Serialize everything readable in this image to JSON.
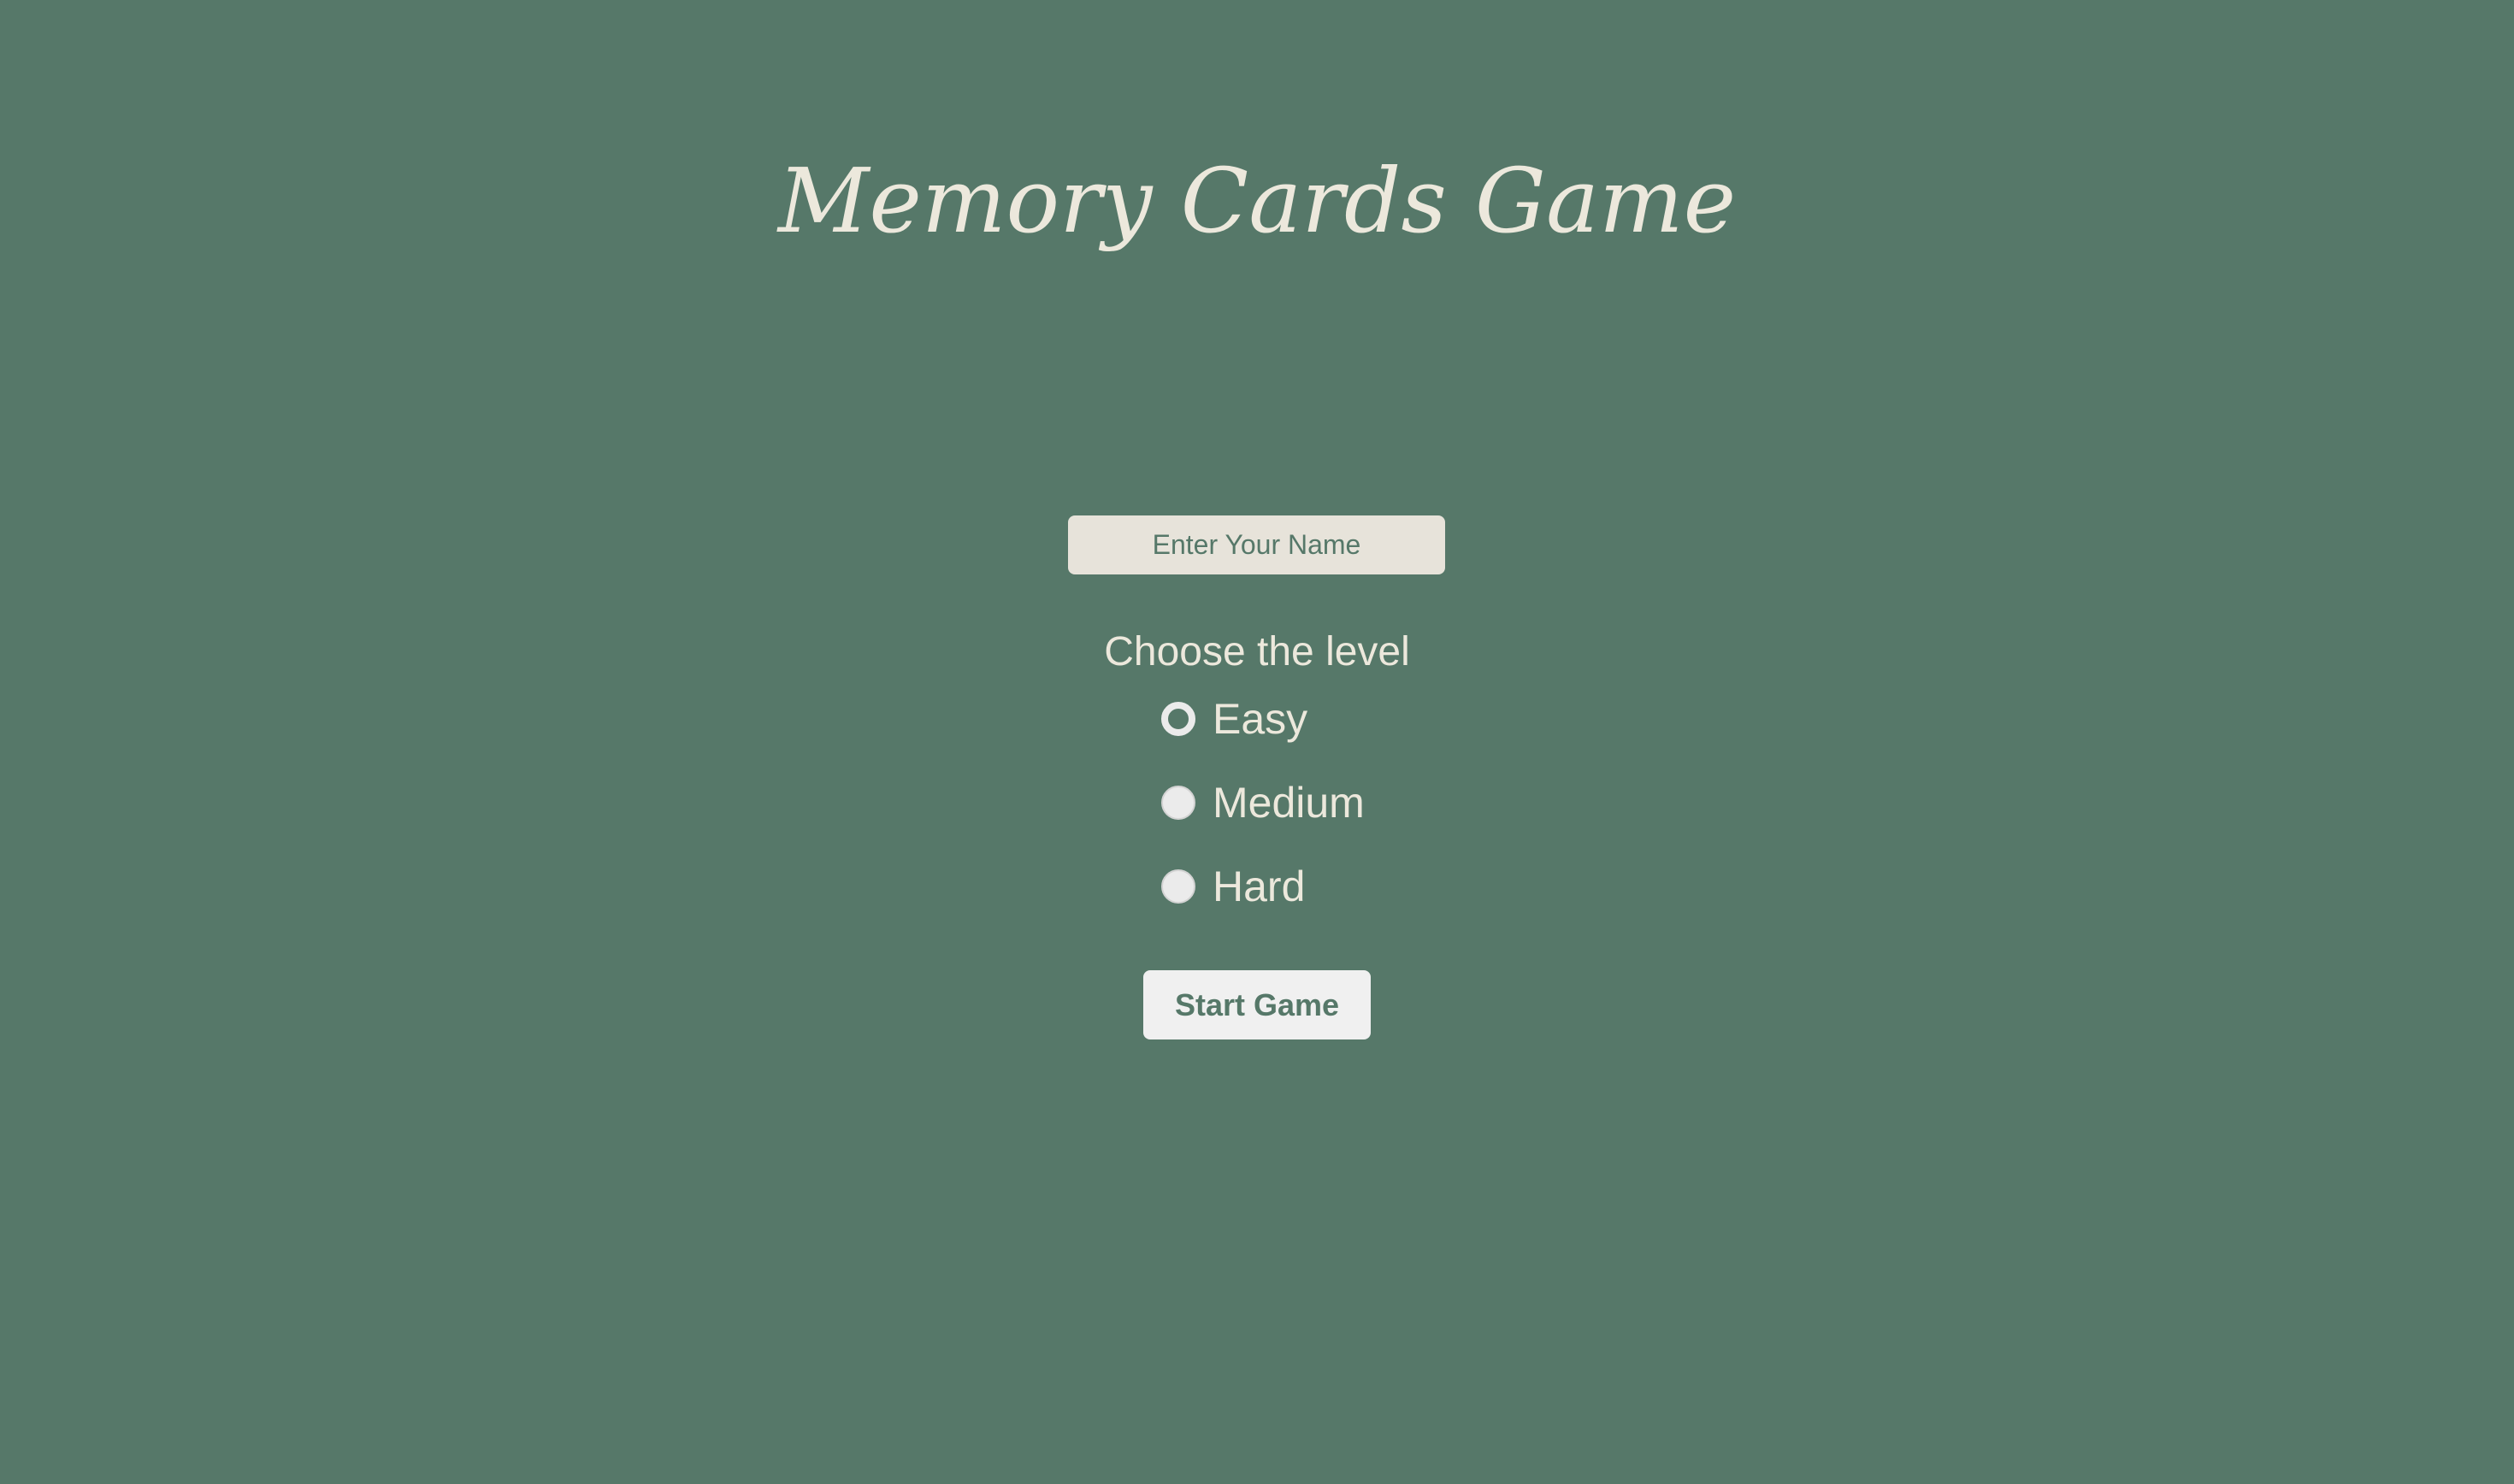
{
  "game": {
    "title": "Memory Cards Game"
  },
  "name_input": {
    "placeholder": "Enter Your Name",
    "value": ""
  },
  "level": {
    "heading": "Choose the level",
    "selected": "Easy",
    "options": [
      {
        "label": "Easy",
        "checked": true
      },
      {
        "label": "Medium",
        "checked": false
      },
      {
        "label": "Hard",
        "checked": false
      }
    ]
  },
  "start_button": {
    "label": "Start Game"
  },
  "colors": {
    "background": "#567869",
    "text": "#ece8dc",
    "input_background": "#e7e3da",
    "button_background": "#f0f0f0"
  }
}
